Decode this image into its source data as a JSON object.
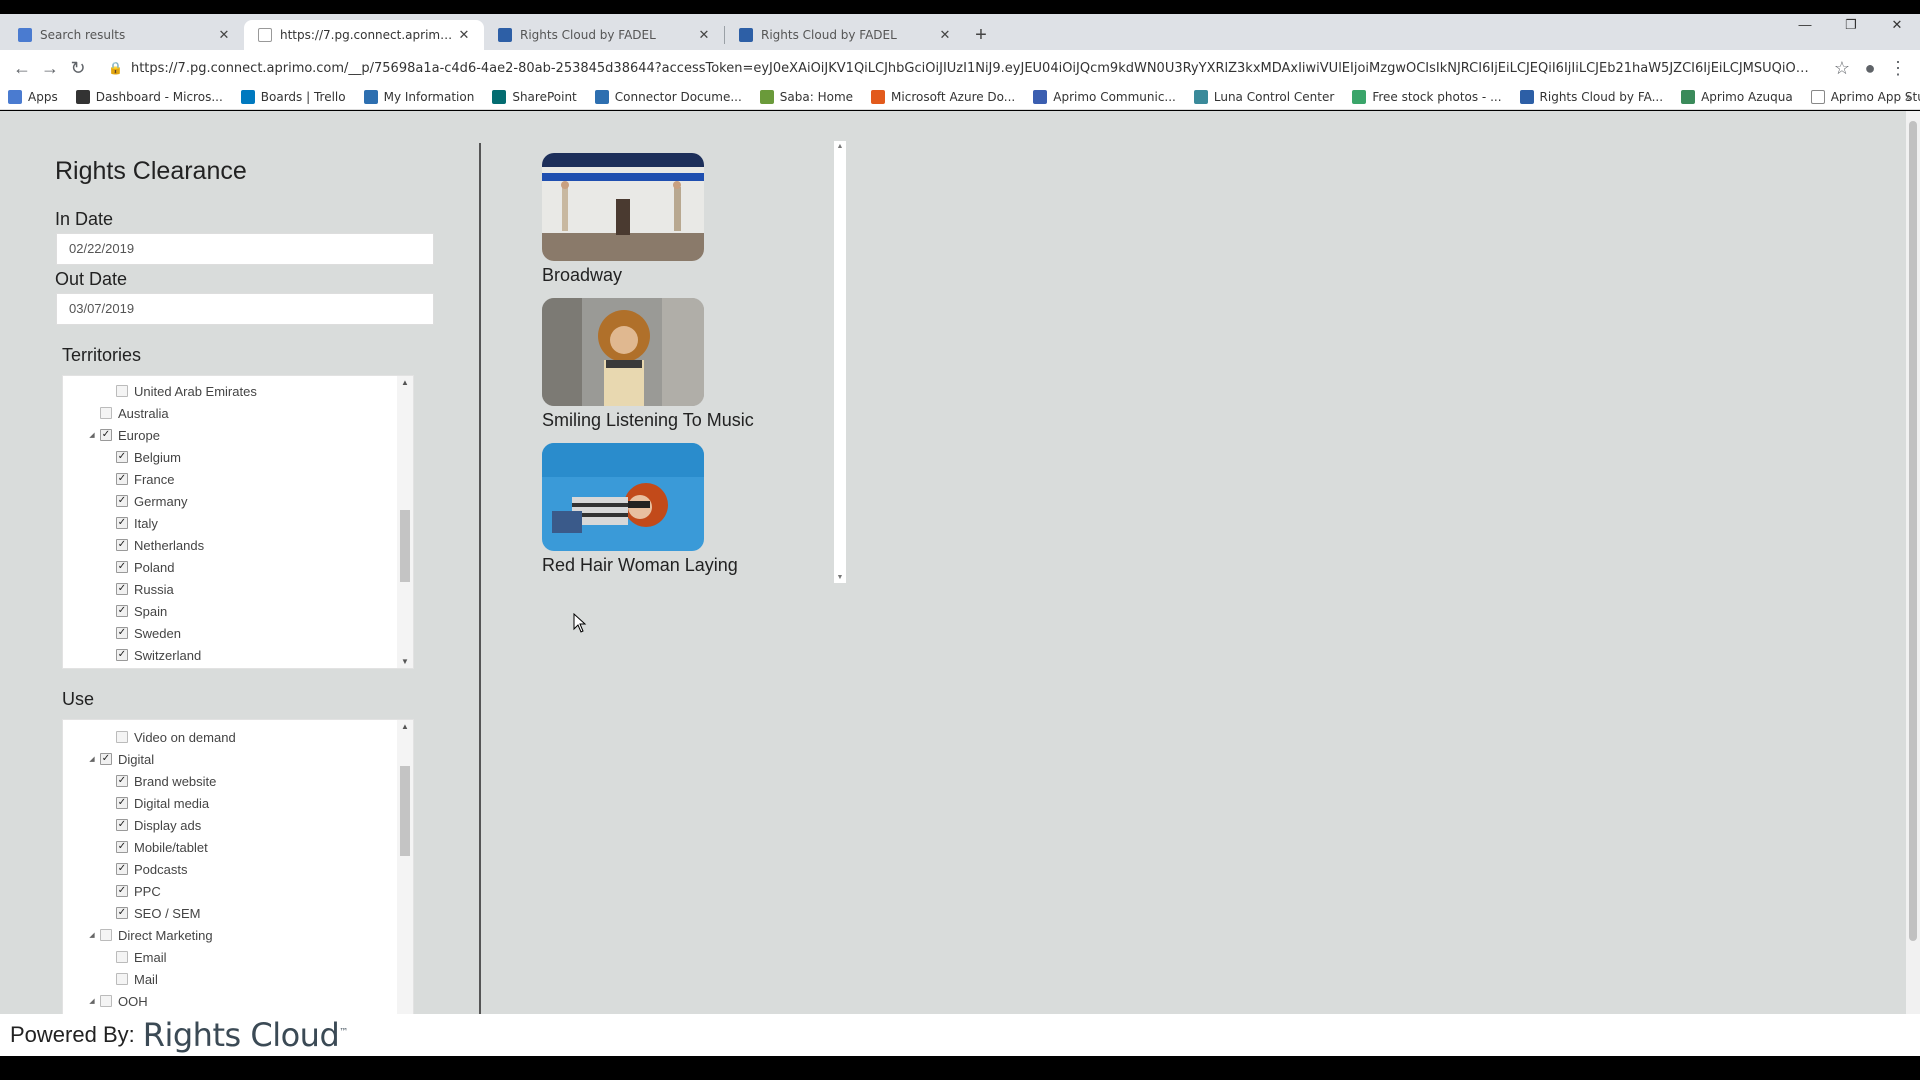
{
  "browser": {
    "tabs": [
      {
        "title": "Search results",
        "icon_color": "#4a7bd0",
        "active": false
      },
      {
        "title": "https://7.pg.connect.aprimo.com/",
        "icon_color": "#999999",
        "active": true
      },
      {
        "title": "Rights Cloud by FADEL",
        "icon_color": "#2d5fa6",
        "active": false
      },
      {
        "title": "Rights Cloud by FADEL",
        "icon_color": "#2d5fa6",
        "active": false
      }
    ],
    "new_tab": "+",
    "url": "https://7.pg.connect.aprimo.com/__p/75698a1a-c4d6-4ae2-80ab-253845d38644?accessToken=eyJ0eXAiOiJKV1QiLCJhbGciOiJIUzI1NiJ9.eyJEU04iOiJQcm9kdWN0U3RyYXRlZ3kxMDAxIiwiVUlEIjoiMzgwOCIsIkNJRCI6IjEiLCJEQiI6IjIiLCJEb21haW5JZCI6IjEiLCJMSUQiOiIxIiwiVE...",
    "bookmarks": [
      {
        "label": "Apps",
        "icon_color": "#4a7bd0"
      },
      {
        "label": "Dashboard - Micros...",
        "icon_color": "#333333"
      },
      {
        "label": "Boards | Trello",
        "icon_color": "#0079bf"
      },
      {
        "label": "My Information",
        "icon_color": "#2d6fb0"
      },
      {
        "label": "SharePoint",
        "icon_color": "#036c70"
      },
      {
        "label": "Connector Docume...",
        "icon_color": "#2d6fb0"
      },
      {
        "label": "Saba: Home",
        "icon_color": "#6a9a3a"
      },
      {
        "label": "Microsoft Azure Do...",
        "icon_color": "#e25a1c"
      },
      {
        "label": "Aprimo Communic...",
        "icon_color": "#3b5eb0"
      },
      {
        "label": "Luna Control Center",
        "icon_color": "#3a8a9a"
      },
      {
        "label": "Free stock photos - ...",
        "icon_color": "#3aa56a"
      },
      {
        "label": "Rights Cloud by FA...",
        "icon_color": "#2d5fa6"
      },
      {
        "label": "Aprimo Azuqua",
        "icon_color": "#3a8a5a"
      },
      {
        "label": "Aprimo App Studio",
        "icon_color": "#888888"
      }
    ],
    "bookmarks_more": "»"
  },
  "app": {
    "title": "Rights Clearance",
    "in_date_label": "In Date",
    "in_date": "02/22/2019",
    "out_date_label": "Out Date",
    "out_date": "03/07/2019",
    "territories_label": "Territories",
    "territories": [
      {
        "label": "United Arab Emirates",
        "level": 2,
        "checked": false,
        "expander": ""
      },
      {
        "label": "Australia",
        "level": 1,
        "checked": false,
        "expander": ""
      },
      {
        "label": "Europe",
        "level": 1,
        "checked": true,
        "expander": "◢"
      },
      {
        "label": "Belgium",
        "level": 2,
        "checked": true,
        "expander": ""
      },
      {
        "label": "France",
        "level": 2,
        "checked": true,
        "expander": ""
      },
      {
        "label": "Germany",
        "level": 2,
        "checked": true,
        "expander": ""
      },
      {
        "label": "Italy",
        "level": 2,
        "checked": true,
        "expander": ""
      },
      {
        "label": "Netherlands",
        "level": 2,
        "checked": true,
        "expander": ""
      },
      {
        "label": "Poland",
        "level": 2,
        "checked": true,
        "expander": ""
      },
      {
        "label": "Russia",
        "level": 2,
        "checked": true,
        "expander": ""
      },
      {
        "label": "Spain",
        "level": 2,
        "checked": true,
        "expander": ""
      },
      {
        "label": "Sweden",
        "level": 2,
        "checked": true,
        "expander": ""
      },
      {
        "label": "Switzerland",
        "level": 2,
        "checked": true,
        "expander": ""
      }
    ],
    "use_label": "Use",
    "uses": [
      {
        "label": "Video on demand",
        "level": 2,
        "checked": false,
        "expander": ""
      },
      {
        "label": "Digital",
        "level": 1,
        "checked": true,
        "expander": "◢"
      },
      {
        "label": "Brand website",
        "level": 2,
        "checked": true,
        "expander": ""
      },
      {
        "label": "Digital media",
        "level": 2,
        "checked": true,
        "expander": ""
      },
      {
        "label": "Display ads",
        "level": 2,
        "checked": true,
        "expander": ""
      },
      {
        "label": "Mobile/tablet",
        "level": 2,
        "checked": true,
        "expander": ""
      },
      {
        "label": "Podcasts",
        "level": 2,
        "checked": true,
        "expander": ""
      },
      {
        "label": "PPC",
        "level": 2,
        "checked": true,
        "expander": ""
      },
      {
        "label": "SEO / SEM",
        "level": 2,
        "checked": true,
        "expander": ""
      },
      {
        "label": "Direct Marketing",
        "level": 1,
        "checked": false,
        "expander": "◢"
      },
      {
        "label": "Email",
        "level": 2,
        "checked": false,
        "expander": ""
      },
      {
        "label": "Mail",
        "level": 2,
        "checked": false,
        "expander": ""
      },
      {
        "label": "OOH",
        "level": 1,
        "checked": false,
        "expander": "◢"
      }
    ],
    "assets": [
      {
        "caption": "Broadway",
        "thumb": "broadway-photo"
      },
      {
        "caption": "Smiling Listening To Music",
        "thumb": "music-photo"
      },
      {
        "caption": "Red Hair Woman Laying",
        "thumb": "red-hair-photo"
      }
    ]
  },
  "footer": {
    "powered_by": "Powered By:",
    "brand": "Rights Cloud",
    "trademark": "™"
  }
}
